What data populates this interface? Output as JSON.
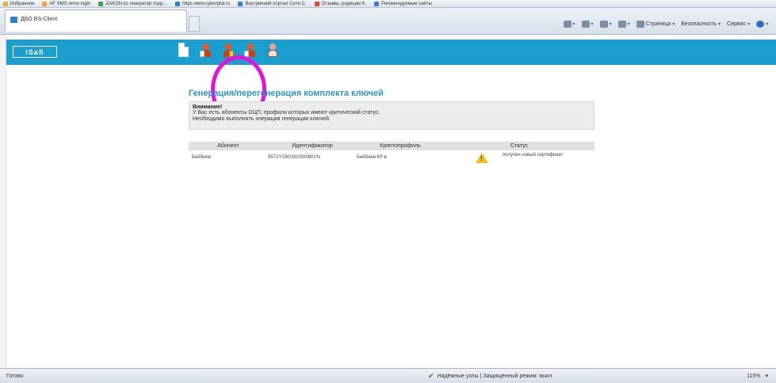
{
  "browser": {
    "favorites": [
      {
        "label": "Избранное",
        "color": "#e9a93c"
      },
      {
        "label": "AF SMS remo login",
        "color": "#e9a93c"
      },
      {
        "label": "ZAKON.kz генератор подс...",
        "color": "#3fa34d"
      },
      {
        "label": "https www.cyberplat.ru",
        "color": "#3d7dc8"
      },
      {
        "label": "Внутренний портал Сити С.",
        "color": "#3d7dc8"
      },
      {
        "label": "Отзывы, родицам К.",
        "color": "#d9483b"
      },
      {
        "label": "Рекомендуемые сайты",
        "color": "#3d7dc8"
      }
    ],
    "tab_title": "ДБО BS-Client",
    "commands": [
      {
        "label": "",
        "icon": "home-icon"
      },
      {
        "label": "",
        "icon": "feeds-icon"
      },
      {
        "label": "",
        "icon": "mail-icon"
      },
      {
        "label": "",
        "icon": "print-icon"
      },
      {
        "label": "Страница",
        "icon": "page-icon"
      },
      {
        "label": "Безопасность",
        "icon": "safety-icon"
      },
      {
        "label": "Сервис",
        "icon": "tools-icon"
      },
      {
        "label": "",
        "icon": "help-icon"
      }
    ]
  },
  "app": {
    "logo": "iSaS",
    "accent_color": "#1c9fcf",
    "toolbar": [
      {
        "name": "new-document-button",
        "icon": "document-icon"
      },
      {
        "name": "user-certificate-button",
        "icon": "user-certificate-icon"
      },
      {
        "name": "user-generate-keys-button",
        "icon": "user-keys-icon"
      },
      {
        "name": "user-key-button",
        "icon": "user-key-icon"
      },
      {
        "name": "user-settings-button",
        "icon": "user-plain-icon"
      }
    ]
  },
  "main": {
    "title": "Генерация/перегенерация комплекта ключей",
    "warning": {
      "title": "Внимание!",
      "lines": [
        "У Вас есть абоненты ОЦП, профили которых имеют критический статус.",
        "Необходимо выполнить операции генерации ключей."
      ]
    },
    "table": {
      "columns": [
        "Абонент",
        "Идентификатор",
        "Криптопрофиль",
        "Статус"
      ],
      "rows": [
        {
          "subscriber": "Бейбиев",
          "identifier": "5572Y1500000000801%",
          "cryptoprofile": "Бейбиев.КР в",
          "status": "получен новый сертификат"
        }
      ]
    }
  },
  "statusbar": {
    "left": "Готово",
    "zone": "Надёжные узлы | Защищённый режим: выкл",
    "zoom": "115%"
  }
}
